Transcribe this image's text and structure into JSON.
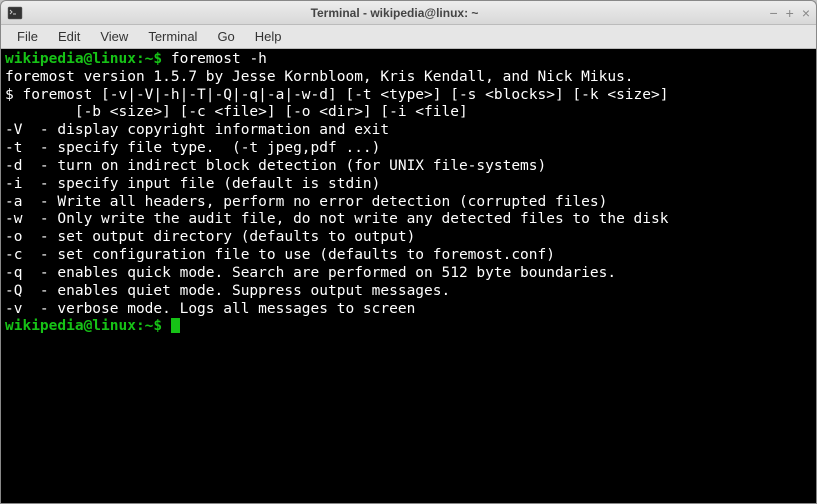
{
  "window": {
    "title": "Terminal - wikipedia@linux: ~"
  },
  "menubar": {
    "items": [
      "File",
      "Edit",
      "View",
      "Terminal",
      "Go",
      "Help"
    ]
  },
  "terminal": {
    "prompt": "wikipedia@linux:~$ ",
    "command1": "foremost -h",
    "output": [
      "foremost version 1.5.7 by Jesse Kornbloom, Kris Kendall, and Nick Mikus.",
      "$ foremost [-v|-V|-h|-T|-Q|-q|-a|-w-d] [-t <type>] [-s <blocks>] [-k <size>]",
      "        [-b <size>] [-c <file>] [-o <dir>] [-i <file]",
      "",
      "-V  - display copyright information and exit",
      "-t  - specify file type.  (-t jpeg,pdf ...)",
      "-d  - turn on indirect block detection (for UNIX file-systems)",
      "-i  - specify input file (default is stdin)",
      "-a  - Write all headers, perform no error detection (corrupted files)",
      "-w  - Only write the audit file, do not write any detected files to the disk",
      "-o  - set output directory (defaults to output)",
      "-c  - set configuration file to use (defaults to foremost.conf)",
      "-q  - enables quick mode. Search are performed on 512 byte boundaries.",
      "-Q  - enables quiet mode. Suppress output messages.",
      "-v  - verbose mode. Logs all messages to screen"
    ]
  }
}
